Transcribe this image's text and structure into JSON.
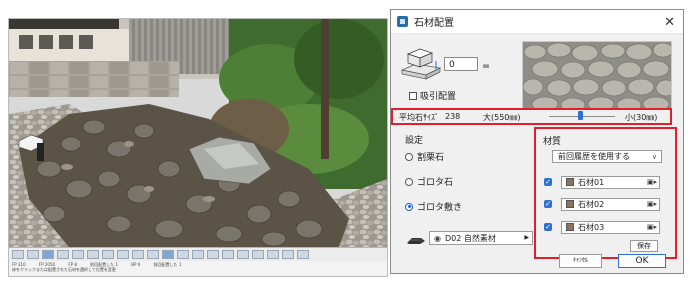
{
  "viewport": {
    "status_line_1": [
      "FP 210",
      "FP 2050",
      "FP 8",
      "前回配置した 1",
      "BP 0",
      "前回配置した 1"
    ],
    "status_line_2": "床をクリックまたは配置された石材を選択して位置を変更"
  },
  "dialog": {
    "title": "石材配置",
    "close_icon": "close-icon",
    "thickness_value": "0",
    "thickness_unit": "㎜",
    "snap_label": "吸引配置",
    "size_label": "平均石ｻｲｽﾞ",
    "size_value": "238",
    "size_large": "大(550㎜)",
    "size_small": "小(30㎜)",
    "size_slider_fraction": 0.48,
    "settings_title": "設定",
    "radios": [
      {
        "label": "割栗石",
        "checked": false
      },
      {
        "label": "ゴロタ石",
        "checked": false
      },
      {
        "label": "ゴロタ敷き",
        "checked": true
      }
    ],
    "material_select": "D02 自然素材",
    "materials_title": "材質",
    "history_option": "前回履歴を使用する",
    "stones": [
      {
        "label": "石材01",
        "checked": true
      },
      {
        "label": "石材02",
        "checked": true
      },
      {
        "label": "石材03",
        "checked": true
      }
    ],
    "save_label": "保存",
    "cancel_label": "ｷｬﾝｾﾙ",
    "ok_label": "OK",
    "accent_color": "#e0202a",
    "checkbox_color": "#2f6fd6"
  }
}
